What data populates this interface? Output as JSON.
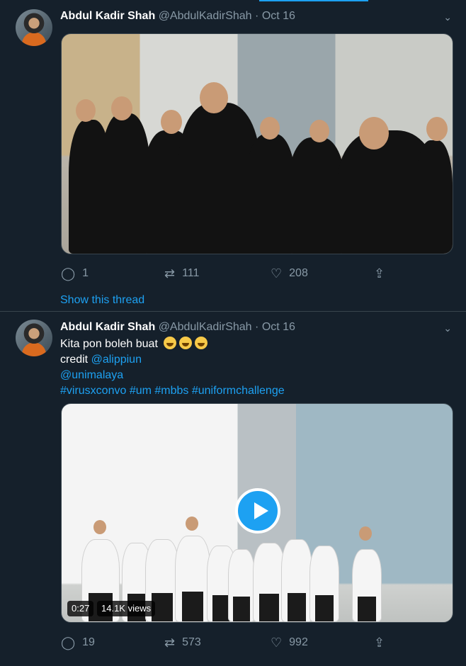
{
  "tweets": [
    {
      "author_name": "Abdul Kadir Shah",
      "handle": "@AbdulKadirShah",
      "separator": "·",
      "date": "Oct 16",
      "stats": {
        "replies": "1",
        "retweets": "111",
        "likes": "208"
      },
      "show_thread": "Show this thread",
      "icons": [
        "reply-icon",
        "retweet-icon",
        "like-icon",
        "share-icon"
      ]
    },
    {
      "author_name": "Abdul Kadir Shah",
      "handle": "@AbdulKadirShah",
      "separator": "·",
      "date": "Oct 16",
      "text_line1": "Kita pon boleh buat",
      "credit_label": "credit",
      "mention1": "@alippiun",
      "mention2": "@unimalaya",
      "hashtags": "#virusxconvo #um #mbbs #uniformchallenge",
      "video_duration": "0:27",
      "video_views": "14.1K views",
      "stats": {
        "replies": "19",
        "retweets": "573",
        "likes": "992"
      }
    }
  ],
  "colors": {
    "background": "#15202b",
    "accent": "#1da1f2",
    "muted": "#8899a6",
    "divider": "#38444d"
  }
}
